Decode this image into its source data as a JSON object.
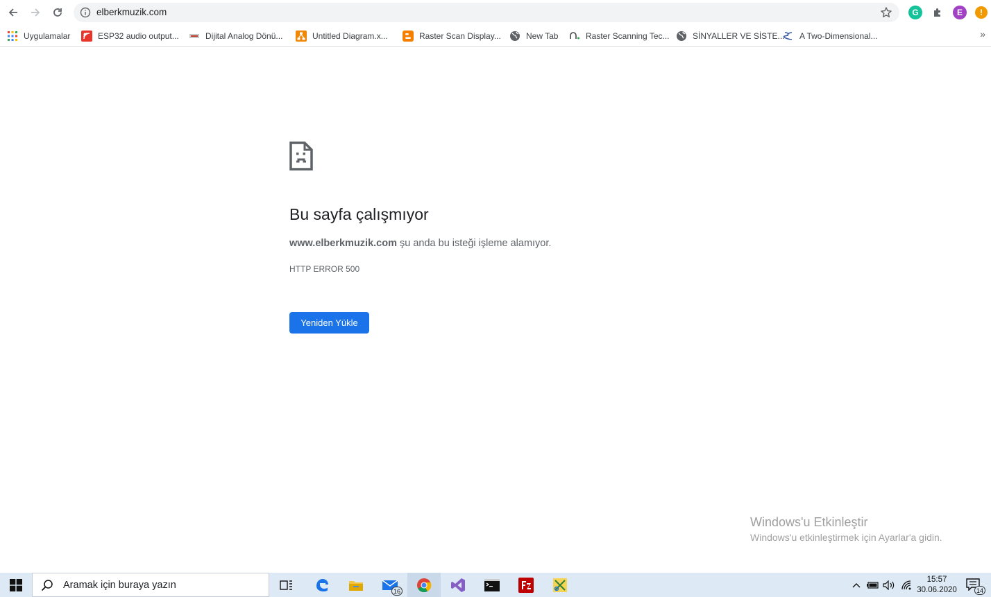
{
  "toolbar": {
    "url": "elberkmuzik.com",
    "profile_letter": "E"
  },
  "bookmarks": [
    {
      "label": "Uygulamalar",
      "icon": "apps-grid-icon"
    },
    {
      "label": "ESP32 audio output...",
      "icon": "espressif-icon"
    },
    {
      "label": "Dijital Analog Dönü...",
      "icon": "site-icon"
    },
    {
      "label": "Untitled Diagram.x...",
      "icon": "drawio-icon"
    },
    {
      "label": "Raster Scan Display...",
      "icon": "blogger-icon"
    },
    {
      "label": "New Tab",
      "icon": "globe-icon"
    },
    {
      "label": "Raster Scanning Tec...",
      "icon": "site-icon"
    },
    {
      "label": "SİNYALLER VE SİSTE...",
      "icon": "globe-icon"
    },
    {
      "label": "A Two-Dimensional...",
      "icon": "site-icon"
    }
  ],
  "error": {
    "title": "Bu sayfa çalışmıyor",
    "domain": "www.elberkmuzik.com",
    "message": " şu anda bu isteği işleme alamıyor.",
    "code": "HTTP ERROR 500",
    "button": "Yeniden Yükle"
  },
  "watermark": {
    "title": "Windows'u Etkinleştir",
    "subtitle": "Windows'u etkinleştirmek için Ayarlar'a gidin."
  },
  "taskbar": {
    "search_placeholder": "Aramak için buraya yazın",
    "mail_badge": "16",
    "time": "15:57",
    "date": "30.06.2020",
    "notification_count": "14"
  },
  "colors": {
    "accent": "#1a73e8",
    "taskbar": "#dde9f4"
  }
}
